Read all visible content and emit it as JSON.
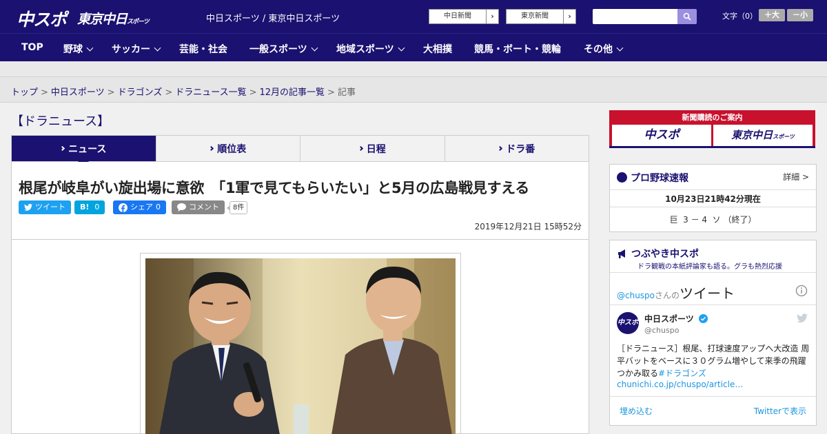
{
  "header": {
    "logo_chuspo": "中スポ",
    "logo_tokyo": "東京中日",
    "logo_tokyo_sub": "スポーツ",
    "site_title": "中日スポーツ / 東京中日スポーツ",
    "paper_buttons": [
      "中日新聞",
      "東京新聞"
    ],
    "font_size_label": "文字（0）",
    "font_larger": "＋大",
    "font_smaller": "－小"
  },
  "nav": {
    "items": [
      {
        "label": "TOP",
        "dropdown": false
      },
      {
        "label": "野球",
        "dropdown": true
      },
      {
        "label": "サッカー",
        "dropdown": true
      },
      {
        "label": "芸能・社会",
        "dropdown": false
      },
      {
        "label": "一般スポーツ",
        "dropdown": true
      },
      {
        "label": "地域スポーツ",
        "dropdown": true
      },
      {
        "label": "大相撲",
        "dropdown": false
      },
      {
        "label": "競馬・ボート・競輪",
        "dropdown": false
      },
      {
        "label": "その他",
        "dropdown": true
      }
    ]
  },
  "breadcrumb": {
    "links": [
      "トップ",
      "中日スポーツ",
      "ドラゴンズ",
      "ドラニュース一覧",
      "12月の記事一覧"
    ],
    "separator": ">",
    "current": "記事"
  },
  "section_title": "【ドラニュース】",
  "tabs": [
    {
      "label": "ニュース",
      "active": true
    },
    {
      "label": "順位表",
      "active": false
    },
    {
      "label": "日程",
      "active": false
    },
    {
      "label": "ドラ番",
      "active": false
    }
  ],
  "article": {
    "headline": "根尾が岐阜がい旋出場に意欲　「1軍で見てもらいたい」と5月の広島戦見すえる",
    "share": {
      "tweet": "ツイート",
      "hatena": "B!",
      "hatena_count": "0",
      "facebook": "シェア",
      "facebook_count": "0",
      "comment": "コメント",
      "comment_count": "8件"
    },
    "datetime": "2019年12月21日 15時52分"
  },
  "sidebar": {
    "promo_title": "新聞購読のご案内",
    "promo_chuspo": "中スポ",
    "promo_tokyo": "東京中日",
    "promo_tokyo_sub": "スポーツ",
    "baseball": {
      "title": "プロ野球速報",
      "detail_link": "詳細 >",
      "timestamp": "10月23日21時42分現在",
      "score": "巨  3 － 4  ソ （終了）"
    },
    "twitter": {
      "title": "つぶやき中スポ",
      "subtitle": "ドラ観戦の本紙評論家も語る。グラも熱烈応援",
      "handle_label": "@chuspo",
      "handle_suffix": "さんの",
      "header_word": "ツイート",
      "user_name": "中日スポーツ",
      "user_handle": "@chuspo",
      "avatar_text": "中スポ",
      "tweet_text": "［ドラニュース］根尾、打球速度アップへ大改造 周平バットをベースに３０グラム増やして来季の飛躍つかみ取る",
      "tweet_hashtag": "#ドラゴンズ",
      "tweet_link": "chunichi.co.jp/chuspo/article…",
      "embed_label": "埋め込む",
      "view_on_twitter": "Twitterで表示"
    }
  },
  "colors": {
    "brand_navy": "#1a1170",
    "twitter_blue": "#1da1f2",
    "hatena_blue": "#00a4de",
    "facebook_blue": "#1877f2",
    "comment_gray": "#888888",
    "promo_red": "#c8112d"
  },
  "icons": [
    "search-icon",
    "twitter-bird-icon",
    "facebook-icon",
    "comment-icon",
    "info-icon",
    "megaphone-icon",
    "baseball-icon",
    "verified-icon"
  ]
}
